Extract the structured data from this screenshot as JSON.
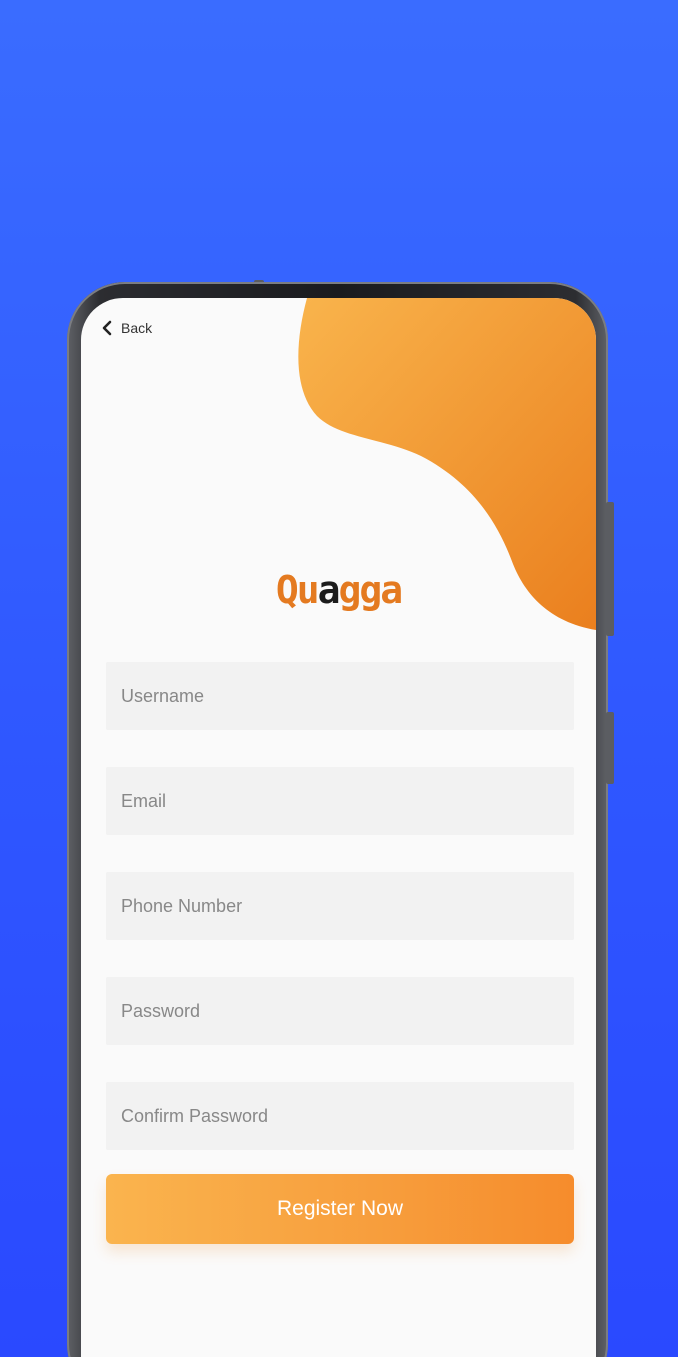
{
  "nav": {
    "back_label": "Back"
  },
  "brand": {
    "part1": "Qua",
    "part2": "gga"
  },
  "form": {
    "username_placeholder": "Username",
    "email_placeholder": "Email",
    "phone_placeholder": "Phone Number",
    "password_placeholder": "Password",
    "confirm_password_placeholder": "Confirm Password",
    "submit_label": "Register Now"
  },
  "colors": {
    "background": "#2f57ff",
    "accent": "#f7a23d",
    "logo_dark": "#1c1c1c",
    "logo_orange": "#e47a20",
    "field_bg": "#f2f2f2"
  },
  "icons": {
    "back": "chevron-left-icon"
  }
}
